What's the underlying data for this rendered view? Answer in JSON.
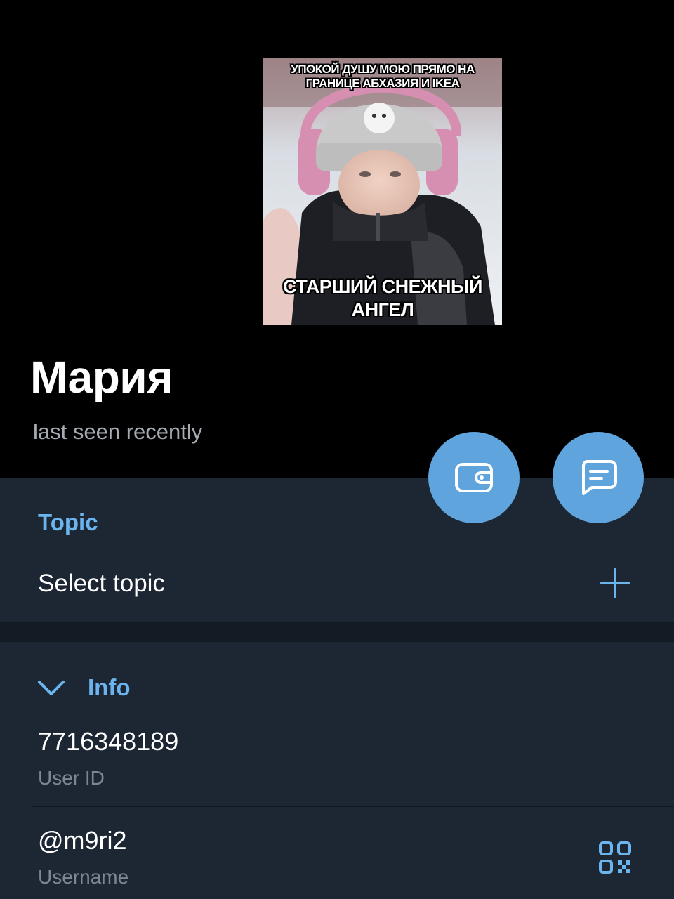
{
  "profile": {
    "name": "Мария",
    "status": "last seen recently",
    "avatar": {
      "caption_top": "УПОКОЙ ДУШУ МОЮ ПРЯМО НА ГРАНИЦЕ АБХАЗИЯ И IKEA",
      "caption_bottom": "СТАРШИЙ СНЕЖНЫЙ АНГЕЛ"
    }
  },
  "actions": {
    "wallet_icon": "wallet-icon",
    "message_icon": "message-icon"
  },
  "topic": {
    "title": "Topic",
    "select_label": "Select topic",
    "add_icon": "plus-icon"
  },
  "info": {
    "title": "Info",
    "toggle_icon": "chevron-down-icon",
    "user_id": {
      "value": "7716348189",
      "label": "User ID"
    },
    "username": {
      "value": "@m9ri2",
      "label": "Username",
      "qr_icon": "qr-code-icon"
    }
  },
  "colors": {
    "accent": "#5fa4dc",
    "accent_text": "#6bb4ee",
    "panel_bg": "#1d2733",
    "divider_bg": "#131b24",
    "header_bg": "#000000",
    "secondary_text": "#7d8791"
  }
}
